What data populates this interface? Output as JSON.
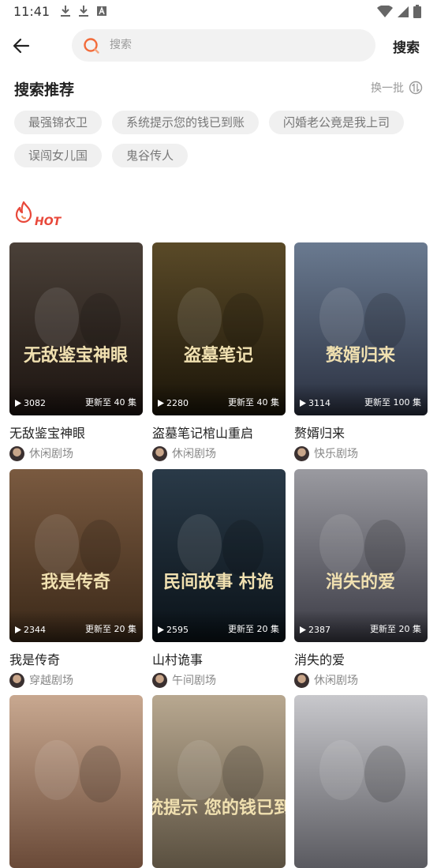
{
  "status_bar": {
    "time": "11:41"
  },
  "search": {
    "placeholder": "搜索",
    "submit_label": "搜索"
  },
  "recommend": {
    "title": "搜索推荐",
    "refresh_label": "换一批",
    "tags": [
      "最强锦衣卫",
      "系统提示您的钱已到账",
      "闪婚老公竟是我上司",
      "误闯女儿国",
      "鬼谷传人"
    ]
  },
  "hot_label": "HOT",
  "cards": [
    {
      "title": "无敌鉴宝神眼",
      "poster_text": "无敌鉴宝神眼",
      "plays": "3082",
      "episodes": "更新至 40 集",
      "channel": "休闲剧场",
      "colors": [
        "#4a4038",
        "#1c1410"
      ]
    },
    {
      "title": "盗墓笔记棺山重启",
      "poster_text": "盗墓笔记",
      "plays": "2280",
      "episodes": "更新至 40 集",
      "channel": "休闲剧场",
      "colors": [
        "#5a4a28",
        "#1a1408"
      ]
    },
    {
      "title": "赘婿归来",
      "poster_text": "赘婿归来",
      "plays": "3114",
      "episodes": "更新至 100 集",
      "channel": "快乐剧场",
      "colors": [
        "#6a7a90",
        "#2a3040"
      ]
    },
    {
      "title": "我是传奇",
      "poster_text": "我是传奇",
      "plays": "2344",
      "episodes": "更新至 20 集",
      "channel": "穿越剧场",
      "colors": [
        "#7a5a40",
        "#3a2818"
      ]
    },
    {
      "title": "山村诡事",
      "poster_text": "民间故事 村诡",
      "plays": "2595",
      "episodes": "更新至 20 集",
      "channel": "午间剧场",
      "colors": [
        "#2a3a48",
        "#0a1218"
      ]
    },
    {
      "title": "消失的爱",
      "poster_text": "消失的爱",
      "plays": "2387",
      "episodes": "更新至 20 集",
      "channel": "休闲剧场",
      "colors": [
        "#9a9aa0",
        "#3a3a44"
      ]
    },
    {
      "title": "",
      "poster_text": "",
      "plays": "",
      "episodes": "",
      "channel": "",
      "colors": [
        "#c8a890",
        "#6a4a38"
      ]
    },
    {
      "title": "",
      "poster_text": "系统提示 您的钱已到账",
      "plays": "",
      "episodes": "",
      "channel": "",
      "colors": [
        "#b8a890",
        "#5a5040"
      ]
    },
    {
      "title": "",
      "poster_text": "",
      "plays": "",
      "episodes": "",
      "channel": "",
      "colors": [
        "#c8c8cc",
        "#5a5a60"
      ]
    }
  ],
  "colors": {
    "accent": "#f26b3a",
    "hot_red": "#e8483a"
  }
}
